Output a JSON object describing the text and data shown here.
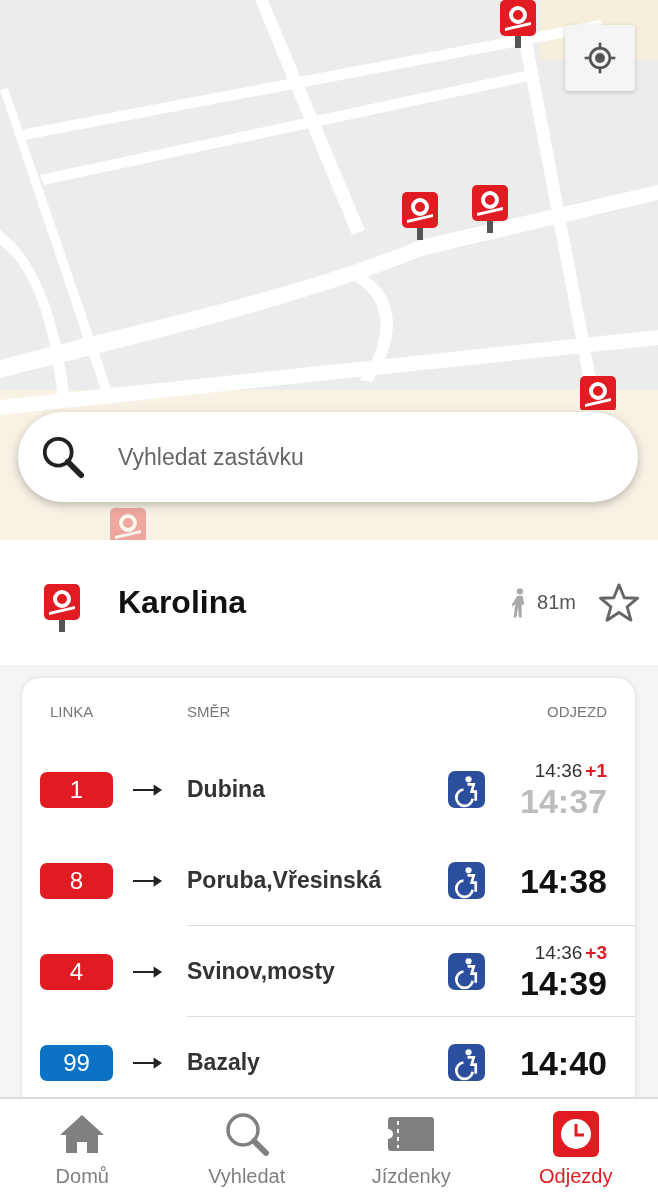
{
  "search": {
    "placeholder": "Vyhledat zastávku"
  },
  "stop": {
    "name": "Karolina",
    "distance": "81m",
    "favorite": false
  },
  "table": {
    "columns": [
      "LINKA",
      "SMĚR",
      "ODJEZD"
    ],
    "rows": [
      {
        "line": "1",
        "color": "#e11b22",
        "direction": "Dubina",
        "accessible": true,
        "scheduled": "14:36",
        "delay": "+1",
        "time": "14:37",
        "departed": true,
        "divider": false
      },
      {
        "line": "8",
        "color": "#e11b22",
        "direction": "Poruba,Vřesinská",
        "accessible": true,
        "time": "14:38",
        "departed": false,
        "divider": true
      },
      {
        "line": "4",
        "color": "#e11b22",
        "direction": "Svinov,mosty",
        "accessible": true,
        "scheduled": "14:36",
        "delay": "+3",
        "time": "14:39",
        "departed": false,
        "divider": true
      },
      {
        "line": "99",
        "color": "#0a72c4",
        "direction": "Bazaly",
        "accessible": true,
        "time": "14:40",
        "departed": false,
        "divider": false
      }
    ]
  },
  "nav": [
    {
      "kind": "home",
      "label": "Domů",
      "selected": false
    },
    {
      "kind": "search",
      "label": "Vyhledat",
      "selected": false
    },
    {
      "kind": "ticket",
      "label": "Jízdenky",
      "selected": false
    },
    {
      "kind": "clock",
      "label": "Odjezdy",
      "selected": true
    }
  ]
}
